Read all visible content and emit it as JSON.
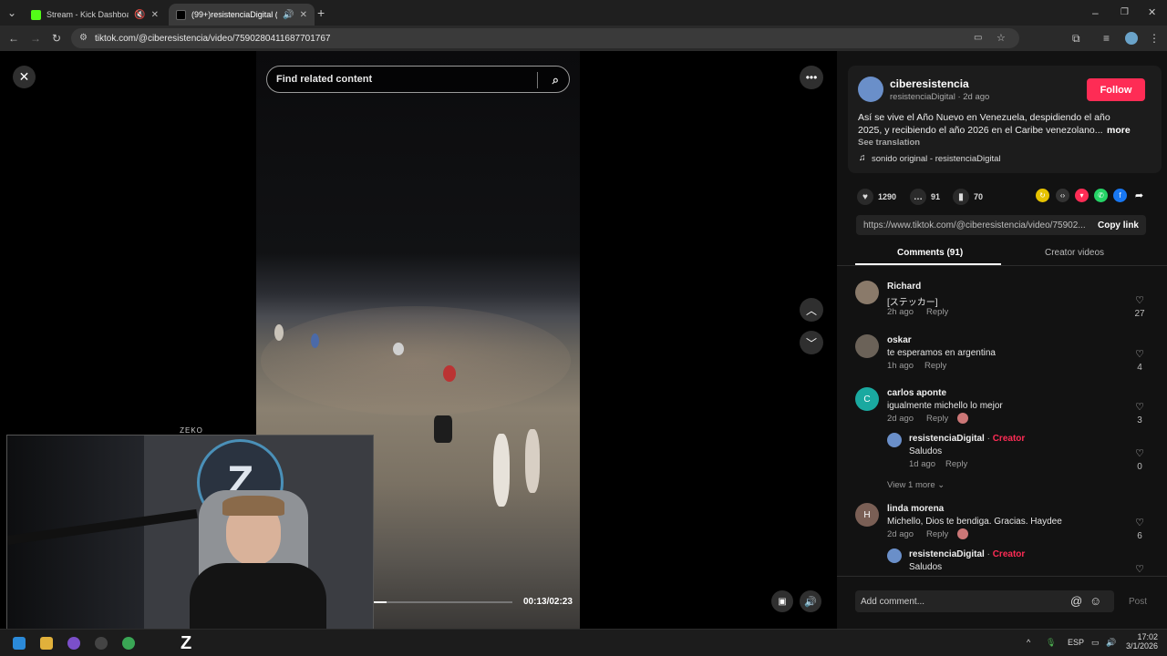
{
  "browser": {
    "tabs": [
      {
        "title": "Stream - Kick Dashboard",
        "active": false
      },
      {
        "title": "(99+)resistenciaDigital (@c",
        "active": true
      }
    ],
    "url": "tiktok.com/@ciberesistencia/video/7590280411687701767"
  },
  "video": {
    "search_placeholder": "Find related content",
    "time": "00:13/02:23",
    "progress_fraction": 0.09
  },
  "cam": {
    "label": "ZEKO"
  },
  "post": {
    "username": "ciberesistencia",
    "byline": "resistenciaDigital · 2d ago",
    "follow_label": "Follow",
    "caption_line1": "Así se vive el Año Nuevo en Venezuela, despidiendo el año",
    "caption_line2": "2025, y recibiendo el año 2026 en el Caribe venezolano...",
    "more_label": "more",
    "see_translation": "See translation",
    "sound": "sonido original - resistenciaDigital",
    "likes": "1290",
    "comments": "91",
    "saves": "70",
    "link": "https://www.tiktok.com/@ciberesistencia/video/75902...",
    "copy_label": "Copy link",
    "tabs": {
      "comments": "Comments (91)",
      "creator": "Creator videos"
    },
    "add_comment_placeholder": "Add comment...",
    "post_label": "Post",
    "accent": "#fe2c55"
  },
  "comments": [
    {
      "name": "Richard",
      "text": "[ステッカー]",
      "time": "2h ago",
      "reply": "Reply",
      "likes": "27"
    },
    {
      "name": "oskar",
      "text": "te esperamos en argentina",
      "time": "1h ago",
      "reply": "Reply",
      "likes": "4"
    },
    {
      "name": "carlos aponte",
      "initial": "C",
      "text": "igualmente michello lo mejor",
      "time": "2d ago",
      "reply": "Reply",
      "likes": "3",
      "reply_item": {
        "name": "resistenciaDigital",
        "sep": " · ",
        "creator": "Creator",
        "text": "Saludos",
        "time": "1d ago",
        "reply": "Reply",
        "likes": "0"
      },
      "view_more": "View 1 more"
    },
    {
      "name": "linda morena",
      "initial": "H",
      "text": "Michello, Dios te bendiga. Gracias. Haydee",
      "time": "2d ago",
      "reply": "Reply",
      "likes": "6",
      "reply_item": {
        "name": "resistenciaDigital",
        "sep": " · ",
        "creator": "Creator",
        "text": "Saludos"
      }
    }
  ],
  "taskbar": {
    "lang": "ESP",
    "time": "17:02",
    "date": "3/1/2026"
  }
}
